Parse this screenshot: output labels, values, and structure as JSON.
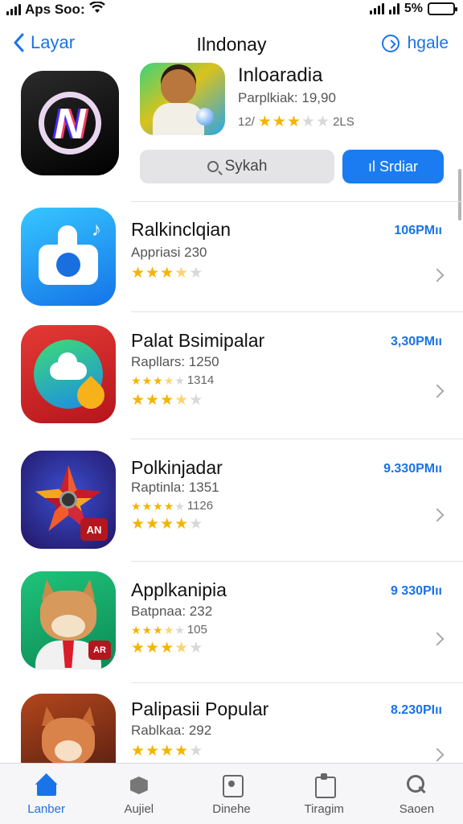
{
  "status_bar": {
    "carrier": "Aps Soo:",
    "battery": "5%"
  },
  "nav": {
    "back_label": "Layar",
    "title": "Ilndonay",
    "action_label": "hgale"
  },
  "featured": {
    "title": "Inloaradia",
    "subtitle": "Parplkiak: 19,90",
    "rating_prefix": "12/",
    "rating_suffix": "2LS",
    "stars": 3,
    "search_label": "Sykah",
    "primary_label": "ıl Srdiar"
  },
  "apps": [
    {
      "name": "Ralkinclqian",
      "sub": "Appriasi 230",
      "sub2": "",
      "stars": 3.5,
      "time": "106PΜıı"
    },
    {
      "name": "Palat Bsimipalar",
      "sub": "Rapllars: 1250",
      "sub2": "1314",
      "stars": 3.5,
      "time": "3,30PΜıı"
    },
    {
      "name": "Polkinjadar",
      "sub": "Raptinla: 1351",
      "sub2": "1126",
      "stars": 4,
      "time": "9.330PΜıı"
    },
    {
      "name": "Applkanipia",
      "sub": "Batpnaa: 232",
      "sub2": "105",
      "stars": 3.5,
      "time": "9 330PIıı"
    },
    {
      "name": "Palipasii Popular",
      "sub": "Rablkaa: 292",
      "sub2": "",
      "stars": 4,
      "time": "8.230PIıı"
    }
  ],
  "tabs": [
    {
      "label": "Lanber",
      "icon": "home-icon",
      "active": true
    },
    {
      "label": "Aujiel",
      "icon": "box-icon",
      "active": false
    },
    {
      "label": "Dinehe",
      "icon": "frame-icon",
      "active": false
    },
    {
      "label": "Tiragim",
      "icon": "clipboard-icon",
      "active": false
    },
    {
      "label": "Saoen",
      "icon": "search-icon",
      "active": false
    }
  ],
  "colors": {
    "accent": "#1a73e8",
    "star": "#f5b400",
    "primary_button": "#1a7cf0"
  }
}
